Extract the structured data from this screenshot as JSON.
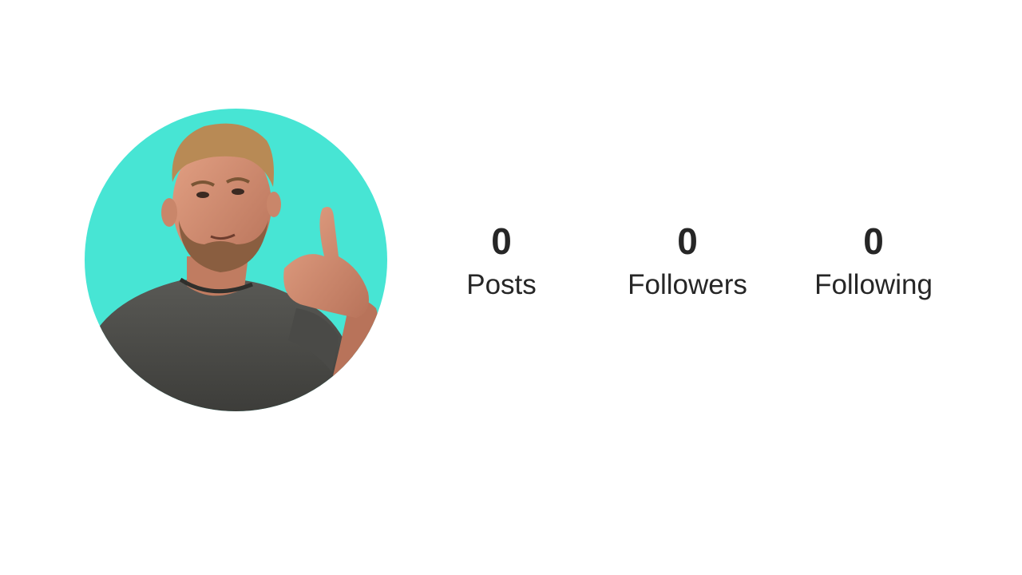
{
  "profile": {
    "avatar": {
      "description_icon": "profile-photo",
      "background_color": "#47e5d4"
    },
    "stats": [
      {
        "count": "0",
        "label": "Posts"
      },
      {
        "count": "0",
        "label": "Followers"
      },
      {
        "count": "0",
        "label": "Following"
      }
    ]
  },
  "colors": {
    "text": "#262626",
    "background": "#ffffff",
    "avatar_bg": "#47e5d4"
  }
}
